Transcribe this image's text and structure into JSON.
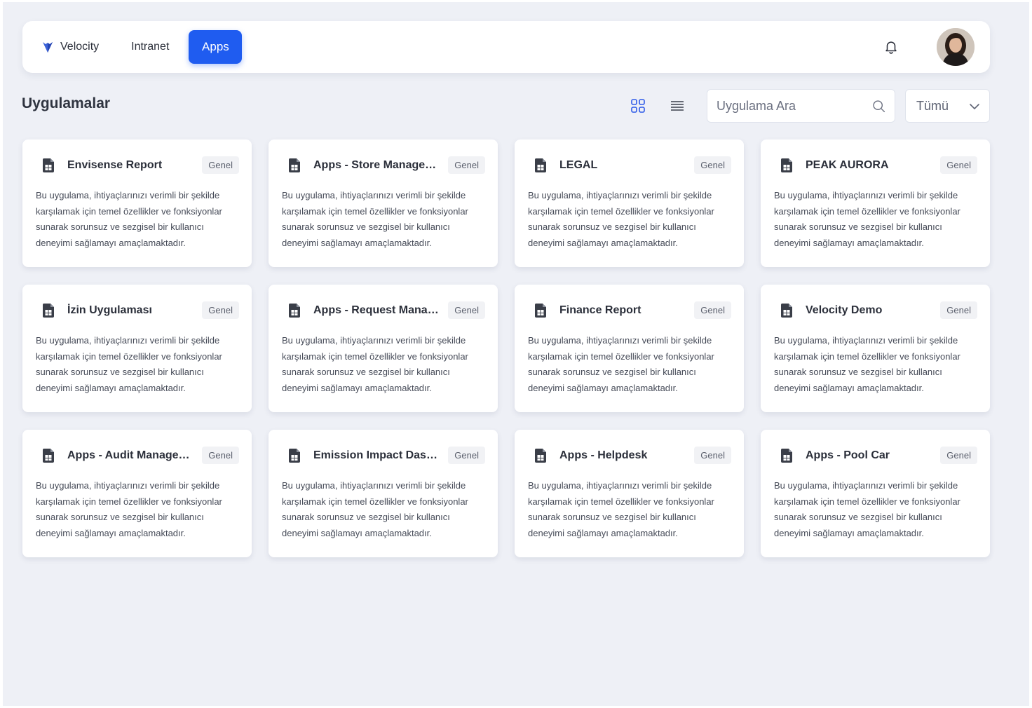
{
  "nav": {
    "brand_label": "Velocity",
    "intranet_label": "Intranet",
    "apps_label": "Apps",
    "accent_color": "#1f5cf0"
  },
  "header": {
    "title": "Uygulamalar",
    "search_placeholder": "Uygulama Ara",
    "filter_value": "Tümü"
  },
  "cards": [
    {
      "title": "Envisense Report",
      "badge": "Genel",
      "description": "Bu uygulama, ihtiyaçlarınızı verimli bir şekilde karşılamak için temel özellikler ve fonksiyonlar sunarak sorunsuz ve sezgisel bir kullanıcı deneyimi sağlamayı amaçlamaktadır."
    },
    {
      "title": "Apps - Store Managem...",
      "badge": "Genel",
      "description": "Bu uygulama, ihtiyaçlarınızı verimli bir şekilde karşılamak için temel özellikler ve fonksiyonlar sunarak sorunsuz ve sezgisel bir kullanıcı deneyimi sağlamayı amaçlamaktadır."
    },
    {
      "title": "LEGAL",
      "badge": "Genel",
      "description": "Bu uygulama, ihtiyaçlarınızı verimli bir şekilde karşılamak için temel özellikler ve fonksiyonlar sunarak sorunsuz ve sezgisel bir kullanıcı deneyimi sağlamayı amaçlamaktadır."
    },
    {
      "title": "PEAK AURORA",
      "badge": "Genel",
      "description": "Bu uygulama, ihtiyaçlarınızı verimli bir şekilde karşılamak için temel özellikler ve fonksiyonlar sunarak sorunsuz ve sezgisel bir kullanıcı deneyimi sağlamayı amaçlamaktadır."
    },
    {
      "title": "İzin Uygulaması",
      "badge": "Genel",
      "description": "Bu uygulama, ihtiyaçlarınızı verimli bir şekilde karşılamak için temel özellikler ve fonksiyonlar sunarak sorunsuz ve sezgisel bir kullanıcı deneyimi sağlamayı amaçlamaktadır."
    },
    {
      "title": "Apps - Request Manag...",
      "badge": "Genel",
      "description": "Bu uygulama, ihtiyaçlarınızı verimli bir şekilde karşılamak için temel özellikler ve fonksiyonlar sunarak sorunsuz ve sezgisel bir kullanıcı deneyimi sağlamayı amaçlamaktadır."
    },
    {
      "title": "Finance Report",
      "badge": "Genel",
      "description": "Bu uygulama, ihtiyaçlarınızı verimli bir şekilde karşılamak için temel özellikler ve fonksiyonlar sunarak sorunsuz ve sezgisel bir kullanıcı deneyimi sağlamayı amaçlamaktadır."
    },
    {
      "title": "Velocity Demo",
      "badge": "Genel",
      "description": "Bu uygulama, ihtiyaçlarınızı verimli bir şekilde karşılamak için temel özellikler ve fonksiyonlar sunarak sorunsuz ve sezgisel bir kullanıcı deneyimi sağlamayı amaçlamaktadır."
    },
    {
      "title": "Apps - Audit Managem...",
      "badge": "Genel",
      "description": "Bu uygulama, ihtiyaçlarınızı verimli bir şekilde karşılamak için temel özellikler ve fonksiyonlar sunarak sorunsuz ve sezgisel bir kullanıcı deneyimi sağlamayı amaçlamaktadır."
    },
    {
      "title": "Emission Impact Dashb...",
      "badge": "Genel",
      "description": "Bu uygulama, ihtiyaçlarınızı verimli bir şekilde karşılamak için temel özellikler ve fonksiyonlar sunarak sorunsuz ve sezgisel bir kullanıcı deneyimi sağlamayı amaçlamaktadır."
    },
    {
      "title": "Apps - Helpdesk",
      "badge": "Genel",
      "description": "Bu uygulama, ihtiyaçlarınızı verimli bir şekilde karşılamak için temel özellikler ve fonksiyonlar sunarak sorunsuz ve sezgisel bir kullanıcı deneyimi sağlamayı amaçlamaktadır."
    },
    {
      "title": "Apps - Pool Car",
      "badge": "Genel",
      "description": "Bu uygulama, ihtiyaçlarınızı verimli bir şekilde karşılamak için temel özellikler ve fonksiyonlar sunarak sorunsuz ve sezgisel bir kullanıcı deneyimi sağlamayı amaçlamaktadır."
    }
  ]
}
